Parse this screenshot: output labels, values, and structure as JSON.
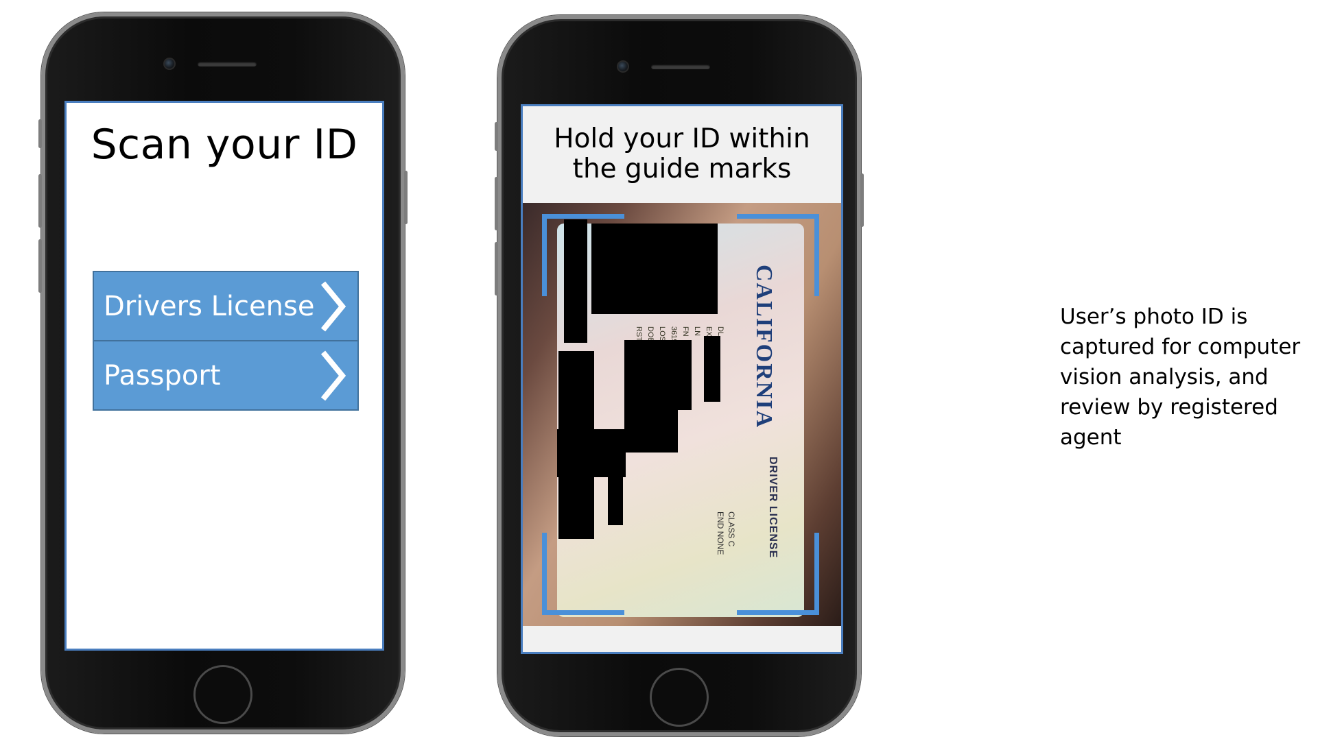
{
  "phone1": {
    "title": "Scan your ID",
    "options": [
      {
        "label": "Drivers License"
      },
      {
        "label": "Passport"
      }
    ]
  },
  "phone2": {
    "title_line1": "Hold your ID within",
    "title_line2": "the guide marks",
    "id_card": {
      "state": "CALIFORNIA",
      "document_type": "DRIVER LICENSE",
      "field_labels": [
        "DL",
        "EXP",
        "LN",
        "FN",
        "3619",
        "LOS",
        "DOB",
        "RSTR CORR LENS"
      ],
      "class_line1": "CLASS C",
      "class_line2": "END NONE"
    }
  },
  "caption": "User’s photo ID is captured for computer vision analysis, and review by registered agent",
  "colors": {
    "button_fill": "#5b9bd5",
    "button_border": "#41719c",
    "screen_border": "#4a7ebf",
    "guide_marks": "#4a90d9"
  },
  "icons": [
    "chevron-right-icon",
    "camera-icon",
    "speaker-icon",
    "home-button-icon"
  ]
}
